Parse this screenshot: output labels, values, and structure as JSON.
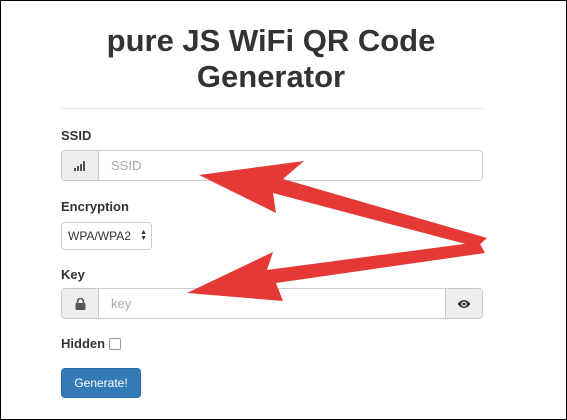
{
  "title_line1": "pure JS WiFi QR Code",
  "title_line2": "Generator",
  "ssid": {
    "label": "SSID",
    "placeholder": "SSID",
    "icon": "signal-icon"
  },
  "encryption": {
    "label": "Encryption",
    "selected": "WPA/WPA2"
  },
  "key": {
    "label": "Key",
    "placeholder": "key",
    "icon": "lock-icon",
    "toggle_icon": "eye-icon"
  },
  "hidden": {
    "label": "Hidden"
  },
  "generate_label": "Generate!",
  "colors": {
    "accent": "#337ab7",
    "arrow": "#e53935"
  }
}
